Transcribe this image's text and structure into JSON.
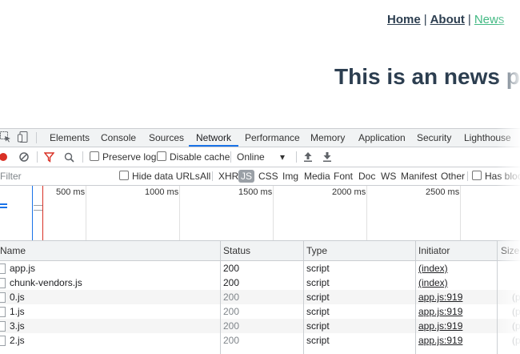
{
  "page": {
    "nav": [
      {
        "label": "Home",
        "active": false
      },
      {
        "label": "About",
        "active": false
      },
      {
        "label": "News",
        "active": true
      }
    ],
    "nav_separator": "|",
    "heading": "This is an news pa"
  },
  "devtools": {
    "tabs": [
      "Elements",
      "Console",
      "Sources",
      "Network",
      "Performance",
      "Memory",
      "Application",
      "Security",
      "Lighthouse"
    ],
    "active_tab": "Network",
    "toolbar": {
      "preserve_log": "Preserve log",
      "disable_cache": "Disable cache",
      "throttling": "Online"
    },
    "filter": {
      "placeholder": "Filter",
      "hide_data_urls": "Hide data URLs",
      "types": [
        "All",
        "XHR",
        "JS",
        "CSS",
        "Img",
        "Media",
        "Font",
        "Doc",
        "WS",
        "Manifest",
        "Other"
      ],
      "selected_type": "JS",
      "has_blocked": "Has block"
    },
    "overview": {
      "ticks": [
        "500 ms",
        "1000 ms",
        "1500 ms",
        "2000 ms",
        "2500 ms"
      ]
    },
    "table": {
      "columns": [
        "Name",
        "Status",
        "Type",
        "Initiator",
        "Size"
      ],
      "rows": [
        {
          "name": "app.js",
          "status": "200",
          "type": "script",
          "initiator": "(index)",
          "size": ""
        },
        {
          "name": "chunk-vendors.js",
          "status": "200",
          "type": "script",
          "initiator": "(index)",
          "size": ""
        },
        {
          "name": "0.js",
          "status": "200",
          "type": "script",
          "initiator": "app.js:919",
          "size": "(p"
        },
        {
          "name": "1.js",
          "status": "200",
          "type": "script",
          "initiator": "app.js:919",
          "size": "(p"
        },
        {
          "name": "3.js",
          "status": "200",
          "type": "script",
          "initiator": "app.js:919",
          "size": "(p"
        },
        {
          "name": "2.js",
          "status": "200",
          "type": "script",
          "initiator": "app.js:919",
          "size": "(p"
        }
      ]
    }
  }
}
